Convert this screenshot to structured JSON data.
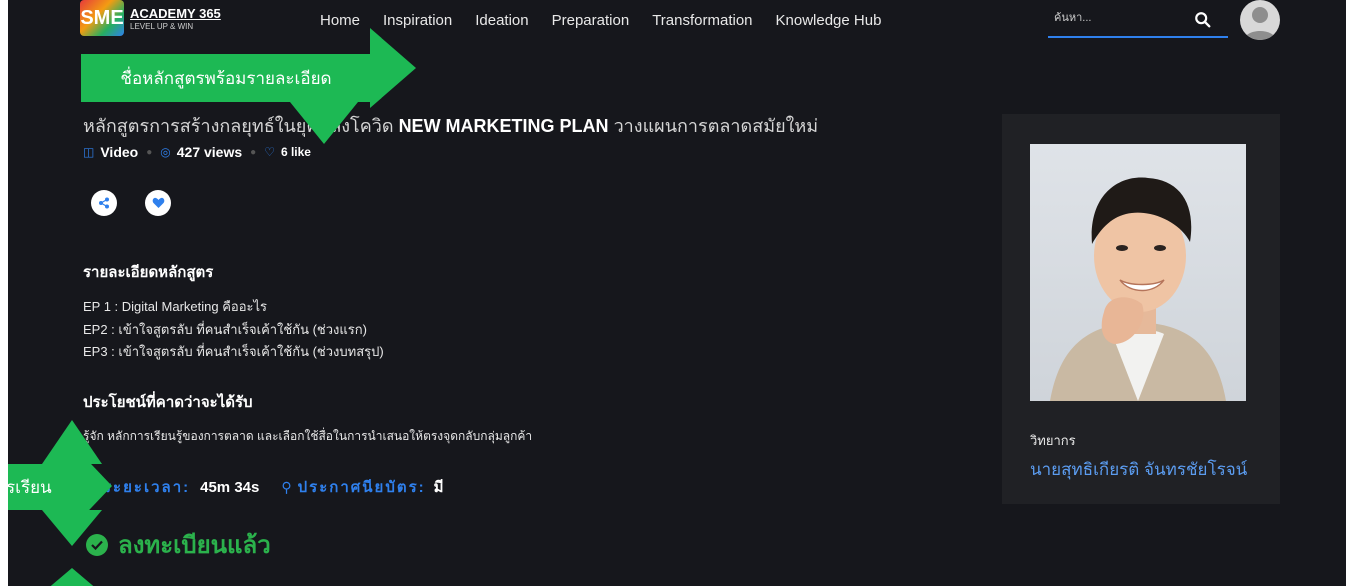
{
  "header": {
    "logo_mark": "SME",
    "logo_title": "ACADEMY 365",
    "logo_sub": "LEVEL UP & WIN",
    "nav": [
      "Home",
      "Inspiration",
      "Ideation",
      "Preparation",
      "Transformation",
      "Knowledge Hub"
    ],
    "search_placeholder": "ค้นหา..."
  },
  "callouts": {
    "course_name": "ชื่อหลักสูตรพร้อมรายละเอียด",
    "duration": "รเรียน"
  },
  "course": {
    "title_prefix": "หลักสูตรการสร้างกลยุทธ์ในยุคหลังโควิด ",
    "title_bold": "NEW MARKETING PLAN",
    "title_suffix": " วางแผนการตลาดสมัยใหม่",
    "type": "Video",
    "views": "427 views",
    "likes": "6 like",
    "details_heading": "รายละเอียดหลักสูตร",
    "episodes": [
      "EP 1 : Digital Marketing คืออะไร",
      "EP2 : เข้าใจสูตรลับ ที่คนสำเร็จเค้าใช้กัน (ช่วงแรก)",
      "EP3 : เข้าใจสูตรลับ ที่คนสำเร็จเค้าใช้กัน (ช่วงบทสรุป)"
    ],
    "benefits_heading": "ประโยชน์ที่คาดว่าจะได้รับ",
    "benefit": "รู้จัก หลักการเรียนรู้ของการตลาด และเลือกใช้สื่อในการนำเสนอให้ตรงจุดกลับกลุ่มลูกค้า",
    "duration_label": "ระยะเวลา:",
    "duration_value": "45m 34s",
    "certificate_label": "ประกาศนียบัตร:",
    "certificate_value": "มี",
    "enrolled_text": "ลงทะเบียนแล้ว"
  },
  "speaker": {
    "label": "วิทยากร",
    "name": "นายสุทธิเกียรติ จันทรชัยโรจน์"
  },
  "colors": {
    "accent": "#2f80ed",
    "callout_green": "#1db954",
    "enrolled_green": "#2bb24c",
    "background": "#16171c"
  }
}
